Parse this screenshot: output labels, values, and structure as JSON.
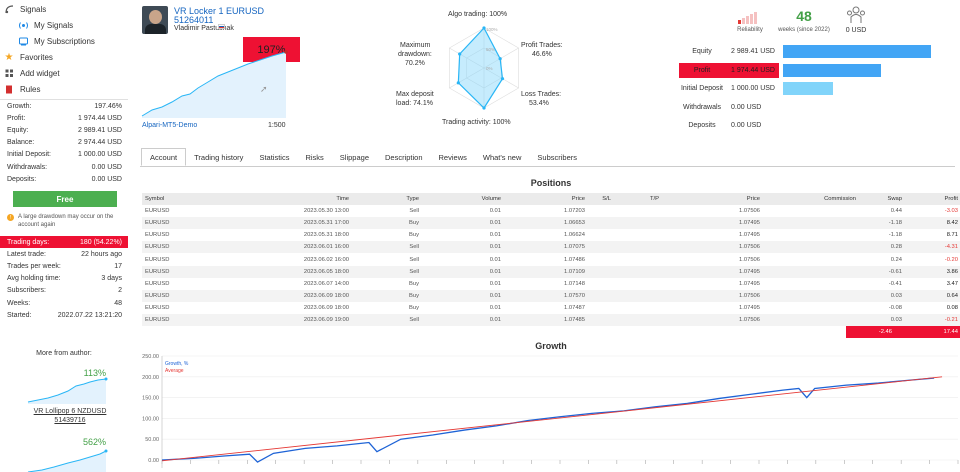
{
  "nav": {
    "signals": "Signals",
    "my_signals": "My Signals",
    "my_subscriptions": "My Subscriptions",
    "favorites": "Favorites",
    "add_widget": "Add widget",
    "rules": "Rules"
  },
  "stats": [
    {
      "label": "Growth:",
      "value": "197.46%"
    },
    {
      "label": "Profit:",
      "value": "1 974.44 USD"
    },
    {
      "label": "Equity:",
      "value": "2 989.41 USD"
    },
    {
      "label": "Balance:",
      "value": "2 974.44 USD"
    },
    {
      "label": "Initial Deposit:",
      "value": "1 000.00 USD"
    },
    {
      "label": "Withdrawals:",
      "value": "0.00 USD"
    },
    {
      "label": "Deposits:",
      "value": "0.00 USD"
    }
  ],
  "free_button": "Free",
  "drawdown_warning": "A large drawdown may occur on the account again",
  "stats2": [
    {
      "label": "Trading days:",
      "value": "180 (54.22%)"
    },
    {
      "label": "Latest trade:",
      "value": "22 hours ago"
    },
    {
      "label": "Trades per week:",
      "value": "17"
    },
    {
      "label": "Avg holding time:",
      "value": "3 days"
    },
    {
      "label": "Subscribers:",
      "value": "2"
    },
    {
      "label": "Weeks:",
      "value": "48"
    },
    {
      "label": "Started:",
      "value": "2022.07.22 13:21:20"
    }
  ],
  "more_from_author": "More from author:",
  "author_signals": [
    {
      "growth": "113%",
      "name": "VR Lollipop 6 NZDUSD",
      "id": "51439716"
    },
    {
      "growth": "562%"
    }
  ],
  "header": {
    "name": "VR Locker 1 EURUSD",
    "id": "51264011",
    "author": "Vladimir Pastushak",
    "growth_badge": "197%",
    "broker": "Alpari-MT5-Demo",
    "leverage": "1:500"
  },
  "radar": {
    "algo": "Algo trading: 100%",
    "profit_trades": "Profit Trades:",
    "profit_trades_val": "46.6%",
    "loss_trades": "Loss Trades:",
    "loss_trades_val": "53.4%",
    "activity": "Trading activity: 100%",
    "max_deposit_load": "Max deposit",
    "max_deposit_load2": "load: 74.1%",
    "max_drawdown": "Maximum",
    "max_drawdown2": "drawdown:",
    "max_drawdown_val": "70.2%",
    "ticks": [
      "100%",
      "50%",
      "0%"
    ],
    "values": {
      "algo": 1.0,
      "profit_trades": 0.466,
      "loss_trades": 0.534,
      "activity": 1.0,
      "deposit_load": 0.741,
      "drawdown": 0.702
    }
  },
  "summary": {
    "reliability": "Reliability",
    "weeks": "48",
    "weeks_label": "weeks (since 2022)",
    "subscribers_money": "0 USD"
  },
  "bars": [
    {
      "label": "Equity",
      "value": "2 989.41 USD",
      "fraction": 1.0,
      "color": "#42a5f5",
      "highlight": false
    },
    {
      "label": "Profit",
      "value": "1 974.44 USD",
      "fraction": 0.66,
      "color": "#42a5f5",
      "highlight": true
    },
    {
      "label": "Initial Deposit",
      "value": "1 000.00 USD",
      "fraction": 0.335,
      "color": "#81d4fa",
      "highlight": false
    },
    {
      "label": "Withdrawals",
      "value": "0.00 USD",
      "fraction": 0,
      "color": "#42a5f5",
      "highlight": false
    },
    {
      "label": "Deposits",
      "value": "0.00 USD",
      "fraction": 0,
      "color": "#42a5f5",
      "highlight": false
    }
  ],
  "tabs": [
    "Account",
    "Trading history",
    "Statistics",
    "Risks",
    "Slippage",
    "Description",
    "Reviews",
    "What's new",
    "Subscribers"
  ],
  "positions": {
    "title": "Positions",
    "columns": [
      "Symbol",
      "Time",
      "Type",
      "Volume",
      "Price",
      "S/L",
      "T/P",
      "Price",
      "Commission",
      "Swap",
      "Profit"
    ],
    "rows": [
      [
        "EURUSD",
        "2023.05.30 13:00",
        "Sell",
        "0.01",
        "1.07203",
        "",
        "",
        "1.07506",
        "",
        "0.44",
        "-3.03"
      ],
      [
        "EURUSD",
        "2023.05.31 17:00",
        "Buy",
        "0.01",
        "1.06653",
        "",
        "",
        "1.07495",
        "",
        "-1.18",
        "8.42"
      ],
      [
        "EURUSD",
        "2023.05.31 18:00",
        "Buy",
        "0.01",
        "1.06624",
        "",
        "",
        "1.07495",
        "",
        "-1.18",
        "8.71"
      ],
      [
        "EURUSD",
        "2023.06.01 16:00",
        "Sell",
        "0.01",
        "1.07075",
        "",
        "",
        "1.07506",
        "",
        "0.28",
        "-4.31"
      ],
      [
        "EURUSD",
        "2023.06.02 16:00",
        "Sell",
        "0.01",
        "1.07486",
        "",
        "",
        "1.07506",
        "",
        "0.24",
        "-0.20"
      ],
      [
        "EURUSD",
        "2023.06.05 18:00",
        "Sell",
        "0.01",
        "1.07109",
        "",
        "",
        "1.07495",
        "",
        "-0.61",
        "3.86"
      ],
      [
        "EURUSD",
        "2023.06.07 14:00",
        "Buy",
        "0.01",
        "1.07148",
        "",
        "",
        "1.07495",
        "",
        "-0.41",
        "3.47"
      ],
      [
        "EURUSD",
        "2023.06.09 18:00",
        "Buy",
        "0.01",
        "1.07570",
        "",
        "",
        "1.07506",
        "",
        "0.03",
        "0.64"
      ],
      [
        "EURUSD",
        "2023.06.09 18:00",
        "Buy",
        "0.01",
        "1.07487",
        "",
        "",
        "1.07495",
        "",
        "-0.08",
        "0.08"
      ],
      [
        "EURUSD",
        "2023.06.09 19:00",
        "Sell",
        "0.01",
        "1.07485",
        "",
        "",
        "1.07506",
        "",
        "0.03",
        "-0.21"
      ]
    ],
    "total_swap": "-2.46",
    "total_profit": "17.44"
  },
  "growth": {
    "title": "Growth",
    "legend_growth": "Growth, %",
    "legend_average": "Average"
  },
  "chart_data": {
    "type": "line",
    "title": "Growth",
    "ylim": [
      0,
      250
    ],
    "yticks": [
      "250.00",
      "200.00",
      "150.00",
      "100.00",
      "50.00",
      "0.00"
    ],
    "series": [
      {
        "name": "Growth, %",
        "color": "#1e63d6",
        "x": [
          0,
          0.04,
          0.08,
          0.11,
          0.12,
          0.14,
          0.18,
          0.22,
          0.26,
          0.27,
          0.3,
          0.34,
          0.38,
          0.42,
          0.46,
          0.5,
          0.54,
          0.58,
          0.62,
          0.66,
          0.7,
          0.74,
          0.78,
          0.8,
          0.81,
          0.82,
          0.86,
          0.9,
          0.94,
          0.97
        ],
        "y": [
          0,
          4,
          10,
          14,
          -5,
          16,
          28,
          34,
          42,
          20,
          50,
          60,
          72,
          82,
          95,
          104,
          112,
          118,
          128,
          136,
          148,
          158,
          168,
          172,
          150,
          172,
          180,
          185,
          192,
          197
        ]
      },
      {
        "name": "Average",
        "color": "#e53935",
        "x": [
          0,
          0.98
        ],
        "y": [
          -2,
          200
        ]
      }
    ]
  }
}
